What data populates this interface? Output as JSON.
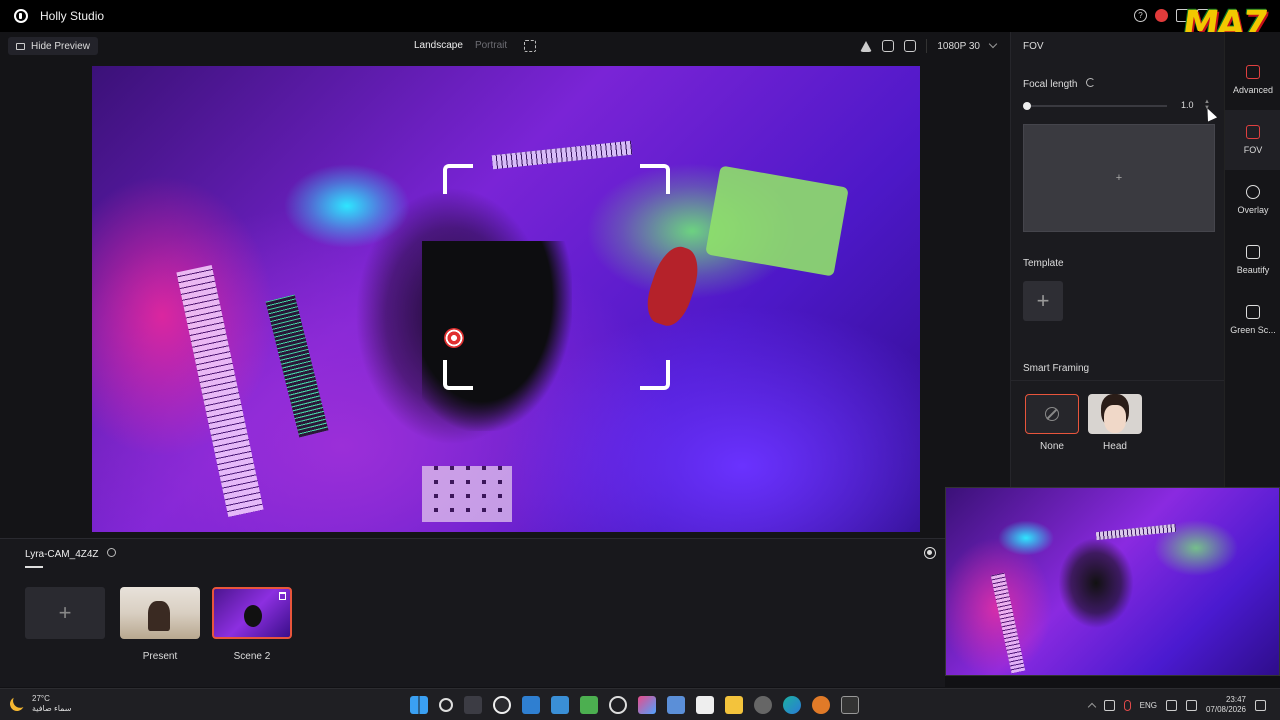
{
  "window": {
    "title": "Holly Studio"
  },
  "toolbar": {
    "hide_preview": "Hide Preview",
    "orientation_active": "Landscape",
    "orientation_inactive": "Portrait",
    "resolution": "1080P 30"
  },
  "scenes": {
    "camera_name": "Lyra-CAM_4Z4Z",
    "add": "+",
    "items": [
      {
        "label": "Present"
      },
      {
        "label": "Scene 2",
        "selected": true
      }
    ]
  },
  "panel": {
    "title": "FOV",
    "focal_length_label": "Focal length",
    "focal_length_value": "1.0",
    "focal_length_fraction": 0.0,
    "add_area": "+",
    "template_label": "Template",
    "template_add": "+",
    "smart_framing_label": "Smart Framing",
    "smart_framing_options": [
      {
        "label": "None",
        "selected": true
      },
      {
        "label": "Head",
        "selected": false
      }
    ]
  },
  "rail": {
    "items": [
      {
        "label": "Advanced",
        "icon": "sliders-icon"
      },
      {
        "label": "FOV",
        "icon": "fov-icon",
        "active": true
      },
      {
        "label": "Overlay",
        "icon": "overlay-icon"
      },
      {
        "label": "Beautify",
        "icon": "beautify-icon"
      },
      {
        "label": "Green Sc...",
        "icon": "green-screen-icon"
      }
    ]
  },
  "watermark": {
    "text": "MA7"
  },
  "taskbar": {
    "weather_temp": "27°C",
    "weather_desc": "سماء صافية",
    "language": "ENG",
    "time": "23:47",
    "date": "07/08/2026"
  },
  "colors": {
    "accent": "#e8553c",
    "record": "#e23b3b",
    "background": "#111114"
  }
}
